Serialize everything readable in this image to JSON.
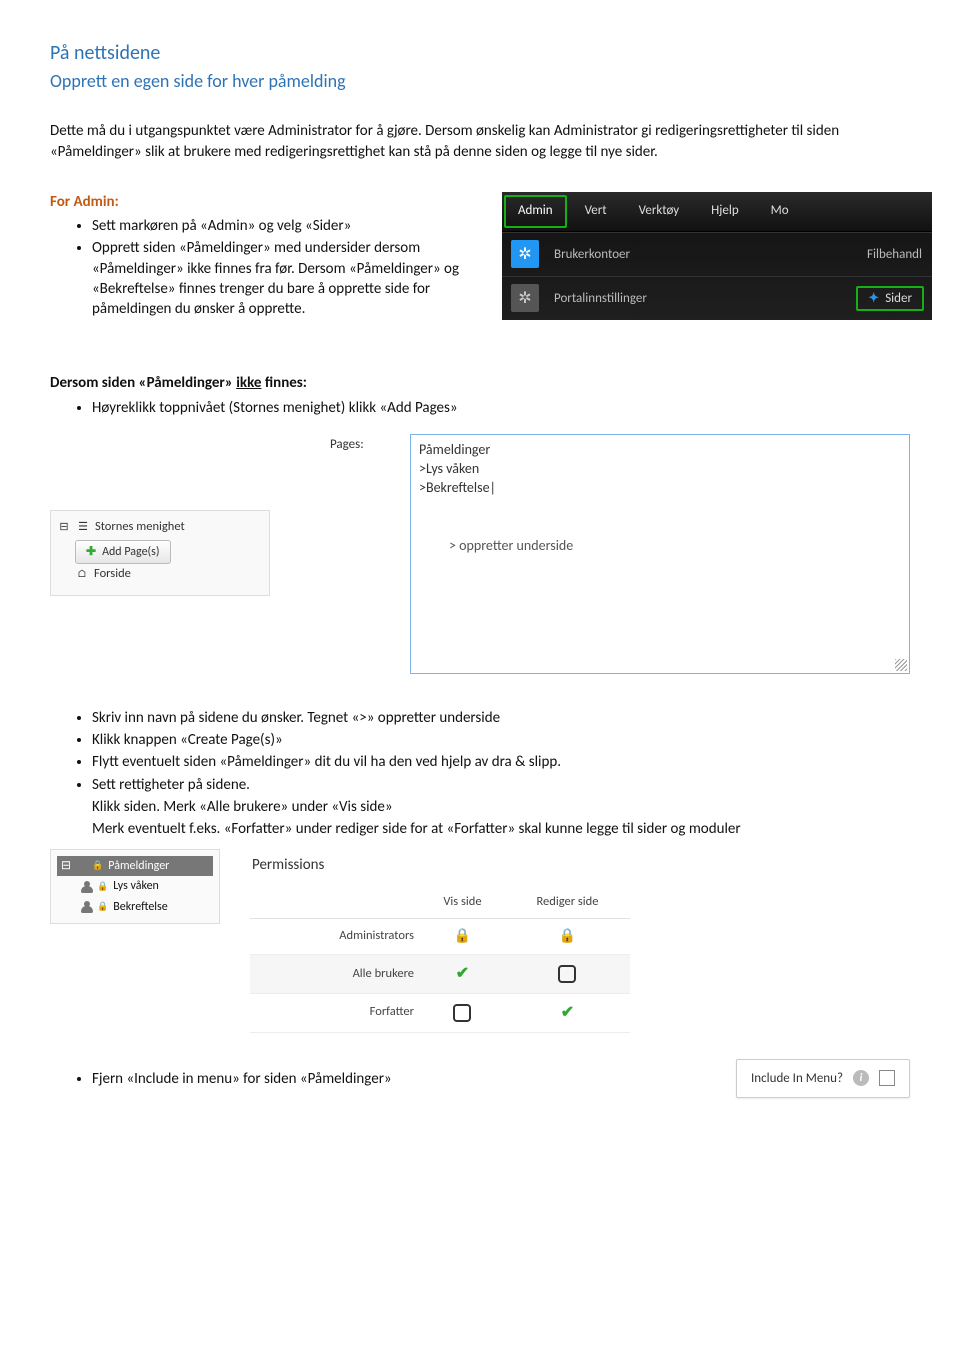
{
  "heading1": "På nettsidene",
  "heading2": "Opprett en egen side for hver påmelding",
  "intro": "Dette må du i utgangspunktet være Administrator for å gjøre. Dersom ønskelig kan Administrator gi redigeringsrettigheter til siden «Påmeldinger» slik at brukere med redigeringsrettighet kan stå på denne siden og legge til nye sider.",
  "for_admin_label": "For Admin:",
  "admin_bullets": [
    "Sett markøren på «Admin» og velg «Sider»",
    "Opprett siden «Påmeldinger» med undersider dersom «Påmeldinger» ikke finnes fra før. Dersom «Påmeldinger» og «Bekreftelse» finnes trenger du bare å opprette side for påmeldingen du ønsker å opprette."
  ],
  "admin_menu": {
    "nav": [
      "Admin",
      "Vert",
      "Verktøy",
      "Hjelp",
      "Mo"
    ],
    "row1": {
      "label": "Brukerkontoer",
      "right": "Filbehandl"
    },
    "row2": {
      "label": "Portalinnstillinger",
      "sider": "Sider"
    }
  },
  "not_found_heading_pre": "Dersom siden «Påmeldinger» ",
  "not_found_heading_underline": "ikke",
  "not_found_heading_post": " finnes:",
  "not_found_bullet": "Høyreklikk toppnivået (Stornes menighet) klikk «Add Pages»",
  "tree": {
    "root": "Stornes menighet",
    "child": "Forside",
    "ctx_button": "Add Page(s)"
  },
  "pages_label": "Pages:",
  "pages_content": [
    "Påmeldinger",
    ">Lys våken",
    ">Bekreftelse|"
  ],
  "pages_note": "> oppretter underside",
  "after_bullets": [
    "Skriv inn navn på sidene du ønsker. Tegnet «>» oppretter underside",
    "Klikk knappen «Create Page(s)»",
    "Flytt eventuelt siden «Påmeldinger» dit du vil ha den ved hjelp av dra & slipp.",
    "Sett rettigheter på sidene."
  ],
  "after_notes": [
    "Klikk siden. Merk «Alle brukere» under «Vis side»",
    "Merk eventuelt f.eks. «Forfatter» under rediger side for at «Forfatter» skal kunne legge til sider og moduler"
  ],
  "perm_tree": {
    "root": "Påmeldinger",
    "children": [
      "Lys våken",
      "Bekreftelse"
    ]
  },
  "permissions": {
    "title": "Permissions",
    "cols": [
      "Vis side",
      "Rediger side"
    ],
    "rows": [
      {
        "label": "Administrators",
        "vis": "lock",
        "rediger": "lock"
      },
      {
        "label": "Alle brukere",
        "vis": "check",
        "rediger": "box"
      },
      {
        "label": "Forfatter",
        "vis": "box",
        "rediger": "check"
      }
    ]
  },
  "final_bullet": "Fjern «Include in menu» for siden «Påmeldinger»",
  "include_box": {
    "label": "Include In Menu?"
  }
}
